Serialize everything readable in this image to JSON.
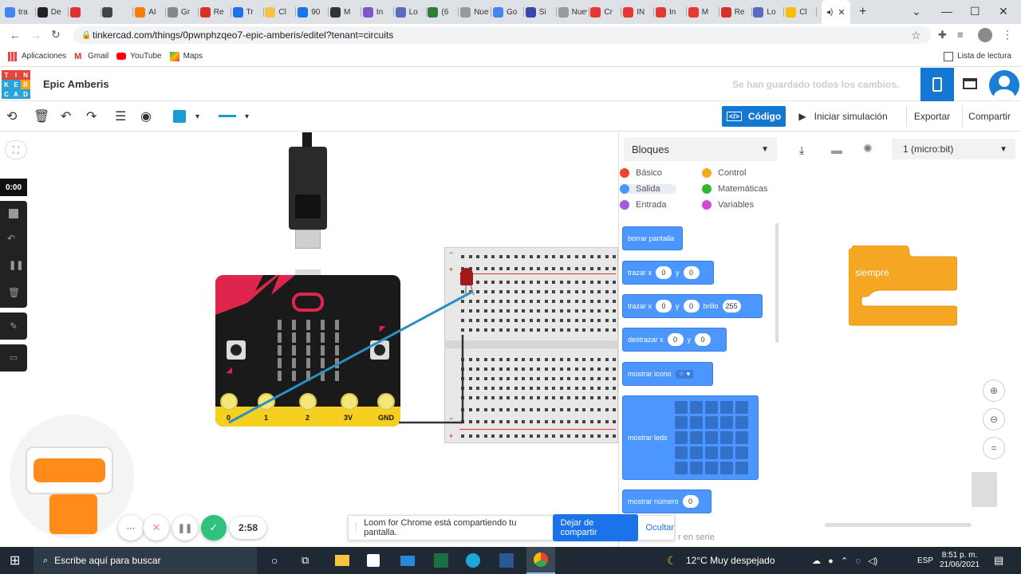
{
  "browser": {
    "tabs": [
      "tra",
      "De",
      "",
      "",
      "AI",
      "Gr",
      "Re",
      "Tr",
      "Cl",
      "90",
      "M",
      "In",
      "Lo",
      "(6",
      "Nueva",
      "Go",
      "Si",
      "Nueva",
      "Cr",
      "IN",
      "In",
      "M",
      "Re",
      "Lo",
      "Cl",
      ""
    ],
    "url": "tinkercad.com/things/0pwnphzqeo7-epic-amberis/editel?tenant=circuits",
    "bookmarks": [
      "Aplicaciones",
      "Gmail",
      "YouTube",
      "Maps"
    ],
    "reading_list": "Lista de lectura"
  },
  "tinkercad": {
    "logo_letters": [
      "T",
      "I",
      "N",
      "K",
      "E",
      "R",
      "C",
      "A",
      "D"
    ],
    "logo_colors": [
      "#e2463c",
      "#e2463c",
      "#e2463c",
      "#29a3d9",
      "#29a3d9",
      "#f5a31a",
      "#29a3d9",
      "#29a3d9",
      "#29a3d9"
    ],
    "project_title": "Epic Amberis",
    "save_status": "Se han guardado todos los cambios.",
    "code_button": "Código",
    "simulate_button": "Iniciar simulación",
    "export_button": "Exportar",
    "share_button": "Compartir",
    "accent_color": "#1477d2"
  },
  "code_panel": {
    "mode_select": "Bloques",
    "device_select": "1 (micro:bit)",
    "categories": [
      {
        "label": "Básico",
        "color": "#e9472c"
      },
      {
        "label": "Control",
        "color": "#f5a623"
      },
      {
        "label": "Salida",
        "color": "#4c97ff"
      },
      {
        "label": "Matemáticas",
        "color": "#2eb82e"
      },
      {
        "label": "Entrada",
        "color": "#a15ae0"
      },
      {
        "label": "Variables",
        "color": "#d54ad5"
      }
    ],
    "blocks": {
      "clear": "borrar pantalla",
      "plot": "trazar x",
      "y": "y",
      "brightness": "brillo",
      "unplot": "destrazar x",
      "show_icon": "mostrar icono",
      "show_leds": "mostrar leds",
      "show_number": "mostrar número",
      "serial_hint": "r en serie",
      "v0": "0",
      "v255": "255"
    },
    "script_block": "siempre"
  },
  "timer": "0:00",
  "microbit_pins": [
    "0",
    "1",
    "2",
    "3V",
    "GND"
  ],
  "loom": {
    "time": "2:58",
    "notice": "Loom for Chrome está compartiendo tu pantalla.",
    "stop_share": "Dejar de compartir",
    "hide": "Ocultar"
  },
  "taskbar": {
    "search": "Escribe aquí para buscar",
    "weather": "12°C  Muy despejado",
    "lang": "ESP",
    "time": "8:51 p. m.",
    "date": "21/06/2021"
  }
}
